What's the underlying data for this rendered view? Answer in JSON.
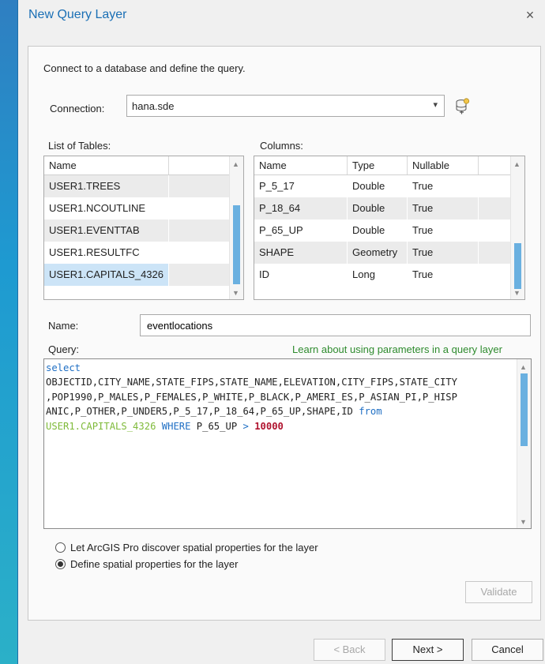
{
  "dialog": {
    "title": "New Query Layer",
    "close_glyph": "×"
  },
  "intro": "Connect to a database and define the query.",
  "connection": {
    "label": "Connection:",
    "value": "hana.sde",
    "dropdown_icon": "chevron-down-icon",
    "new_connection_icon": "database-connection-icon"
  },
  "tables": {
    "label": "List of Tables:",
    "header": "Name",
    "rows": [
      "USER1.TREES",
      "USER1.NCOUTLINE",
      "USER1.EVENTTAB",
      "USER1.RESULTFC",
      "USER1.CAPITALS_4326"
    ],
    "selected_row": "USER1.CAPITALS_4326"
  },
  "columns": {
    "label": "Columns:",
    "headers": [
      "Name",
      "Type",
      "Nullable"
    ],
    "rows": [
      [
        "P_5_17",
        "Double",
        "True"
      ],
      [
        "P_18_64",
        "Double",
        "True"
      ],
      [
        "P_65_UP",
        "Double",
        "True"
      ],
      [
        "SHAPE",
        "Geometry",
        "True"
      ],
      [
        "ID",
        "Long",
        "True"
      ]
    ]
  },
  "name": {
    "label": "Name:",
    "value": "eventlocations"
  },
  "query": {
    "label": "Query:",
    "help_link": "Learn about using parameters in a query layer",
    "lines": [
      [
        {
          "t": "select",
          "c": "kw"
        }
      ],
      [
        {
          "t": "OBJECTID,CITY_NAME,STATE_FIPS,STATE_NAME,ELEVATION,CITY_FIPS,STATE_CITY",
          "c": "plain"
        }
      ],
      [
        {
          "t": ",POP1990,P_MALES,P_FEMALES,P_WHITE,P_BLACK,P_AMERI_ES,P_ASIAN_PI,P_HISP",
          "c": "plain"
        }
      ],
      [
        {
          "t": "ANIC,P_OTHER,P_UNDER5,P_5_17,P_18_64,P_65_UP,SHAPE,ID ",
          "c": "plain"
        },
        {
          "t": "from",
          "c": "kw"
        }
      ],
      [
        {
          "t": "USER1.CAPITALS_4326",
          "c": "tbl"
        },
        {
          "t": " ",
          "c": "plain"
        },
        {
          "t": "WHERE",
          "c": "kw"
        },
        {
          "t": " P_65_UP ",
          "c": "plain"
        },
        {
          "t": ">",
          "c": "kw"
        },
        {
          "t": " ",
          "c": "plain"
        },
        {
          "t": "10000",
          "c": "num"
        }
      ]
    ]
  },
  "spatial": {
    "option_discover": "Let ArcGIS Pro discover spatial properties for the layer",
    "option_define": "Define spatial properties for the layer",
    "selected": "define"
  },
  "buttons": {
    "validate": "Validate",
    "back": "< Back",
    "next": "Next >",
    "cancel": "Cancel"
  },
  "colors": {
    "title": "#1a6fb5",
    "selection": "#cce4f7",
    "row_alt": "#ebebeb",
    "link": "#2e8b2e",
    "sql_keyword": "#1f6fc4",
    "sql_table": "#7fba3a",
    "sql_number": "#b0142f"
  }
}
